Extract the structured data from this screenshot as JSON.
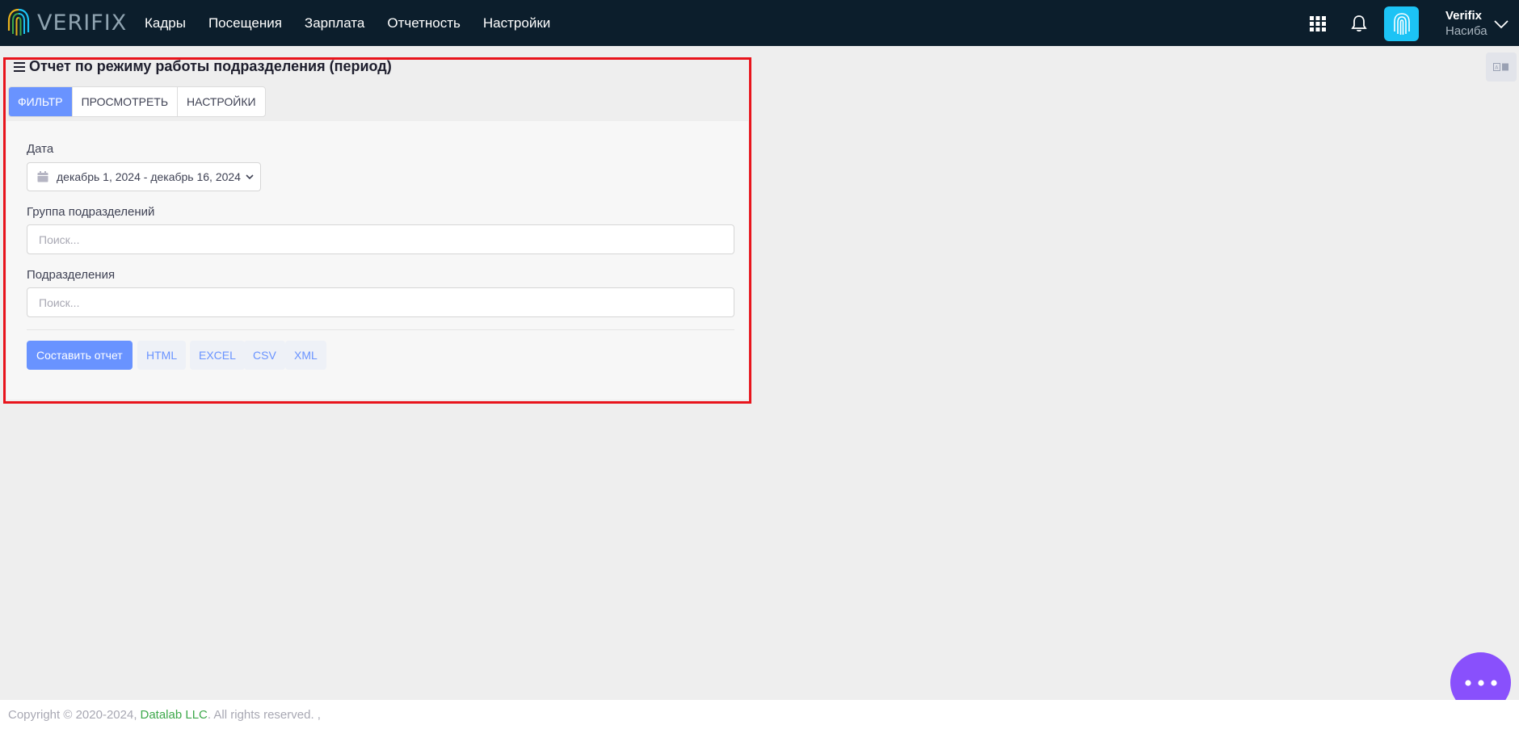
{
  "header": {
    "logo_text": "VERIFIX",
    "nav": [
      {
        "label": "Кадры"
      },
      {
        "label": "Посещения"
      },
      {
        "label": "Зарплата"
      },
      {
        "label": "Отчетность"
      },
      {
        "label": "Настройки"
      }
    ],
    "user": {
      "name": "Verifix",
      "sub": "Насиба"
    },
    "icons": [
      "grid-icon",
      "bell-icon",
      "fingerprint-icon",
      "chevron-down-icon"
    ]
  },
  "page": {
    "title": "Отчет по режиму работы подразделения (период)",
    "tabs": [
      {
        "label": "Фильтр",
        "active": true
      },
      {
        "label": "Просмотреть",
        "active": false
      },
      {
        "label": "Настройки",
        "active": false
      }
    ]
  },
  "filter": {
    "date_label": "Дата",
    "date_value": "декабрь 1, 2024 - декабрь 16, 2024",
    "group_label": "Группа подразделений",
    "group_placeholder": "Поиск...",
    "division_label": "Подразделения",
    "division_placeholder": "Поиск..."
  },
  "actions": {
    "build": "Составить отчет",
    "html": "HTML",
    "excel": "EXCEL",
    "csv": "CSV",
    "xml": "XML"
  },
  "footer": {
    "copyright": "Copyright © 2020-2024,",
    "company": "Datalab LLC",
    "rights": ". All rights reserved. ,"
  },
  "colors": {
    "header_bg": "#0c1e2c",
    "accent": "#6993ff",
    "highlight": "#e8141c",
    "fab": "#8950fc",
    "fingerprint_btn": "#1cc3f5"
  }
}
